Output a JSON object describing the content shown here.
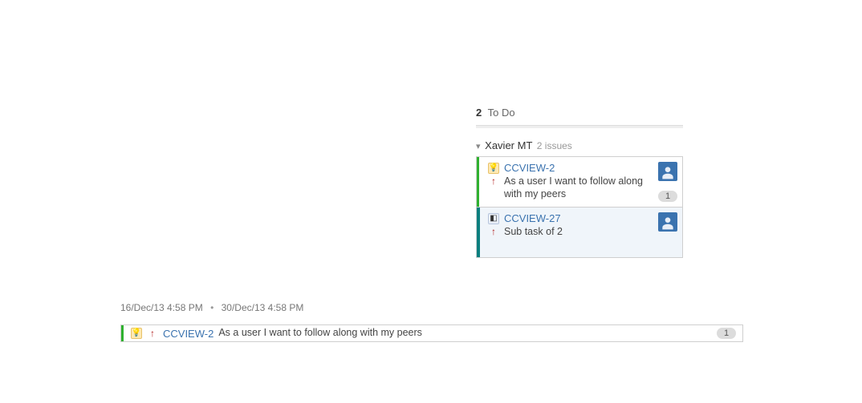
{
  "column": {
    "count": "2",
    "title": "To Do"
  },
  "swimlane": {
    "name": "Xavier MT",
    "subtext": "2 issues"
  },
  "cards": [
    {
      "barClass": "green",
      "typeIcon": "story",
      "typeGlyph": "💡",
      "key": "CCVIEW-2",
      "summary": "As a user I want to follow along with my peers",
      "badge": "1",
      "selected": false
    },
    {
      "barClass": "teal",
      "typeIcon": "subtask",
      "typeGlyph": "◧",
      "key": "CCVIEW-27",
      "summary": "Sub task of 2",
      "badge": null,
      "selected": true
    }
  ],
  "bottom": {
    "date1": "16/Dec/13 4:58 PM",
    "date2": "30/Dec/13 4:58 PM",
    "card": {
      "barClass": "green",
      "typeIcon": "story",
      "typeGlyph": "💡",
      "key": "CCVIEW-2",
      "summary": "As a user I want to follow along with my peers",
      "badge": "1"
    }
  }
}
